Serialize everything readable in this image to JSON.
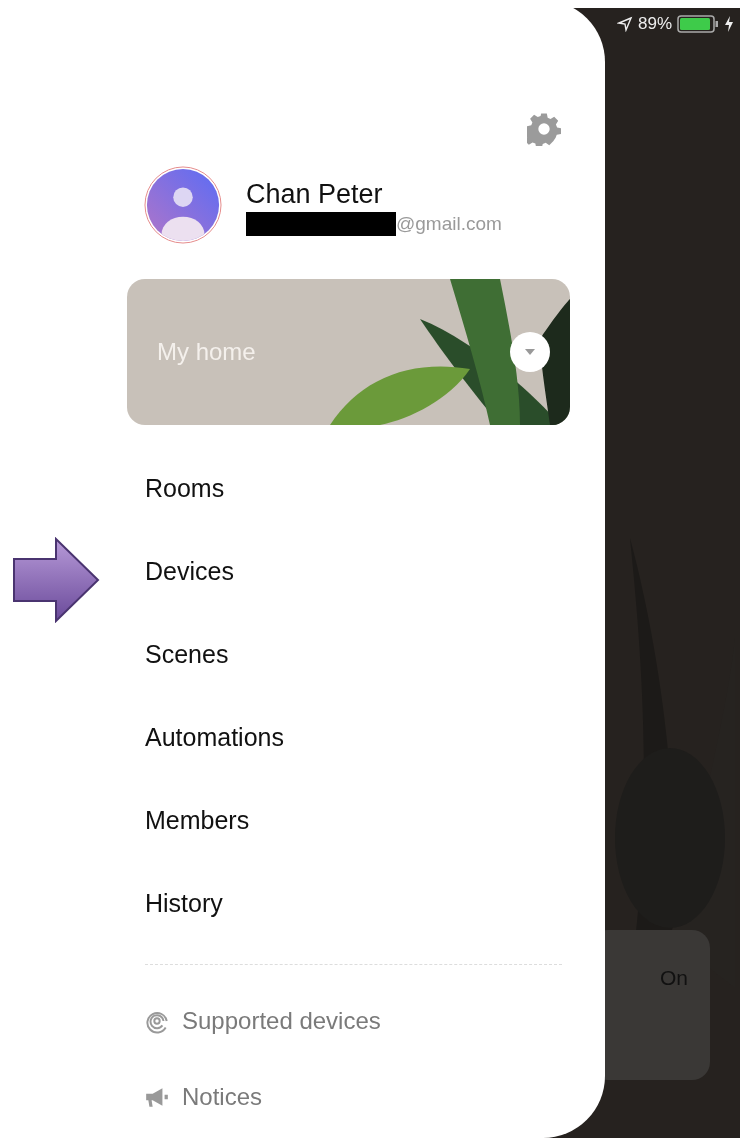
{
  "status_bar": {
    "battery": "89%"
  },
  "profile": {
    "name": "Chan Peter",
    "email": "@gmail.com"
  },
  "home_card": {
    "label": "My home"
  },
  "menu": [
    {
      "label": "Rooms"
    },
    {
      "label": "Devices"
    },
    {
      "label": "Scenes"
    },
    {
      "label": "Automations"
    },
    {
      "label": "Members"
    },
    {
      "label": "History"
    }
  ],
  "footer_links": [
    {
      "kind": "supported",
      "label": "Supported devices"
    },
    {
      "kind": "notices",
      "label": "Notices"
    }
  ],
  "background_card": {
    "state": "On"
  }
}
